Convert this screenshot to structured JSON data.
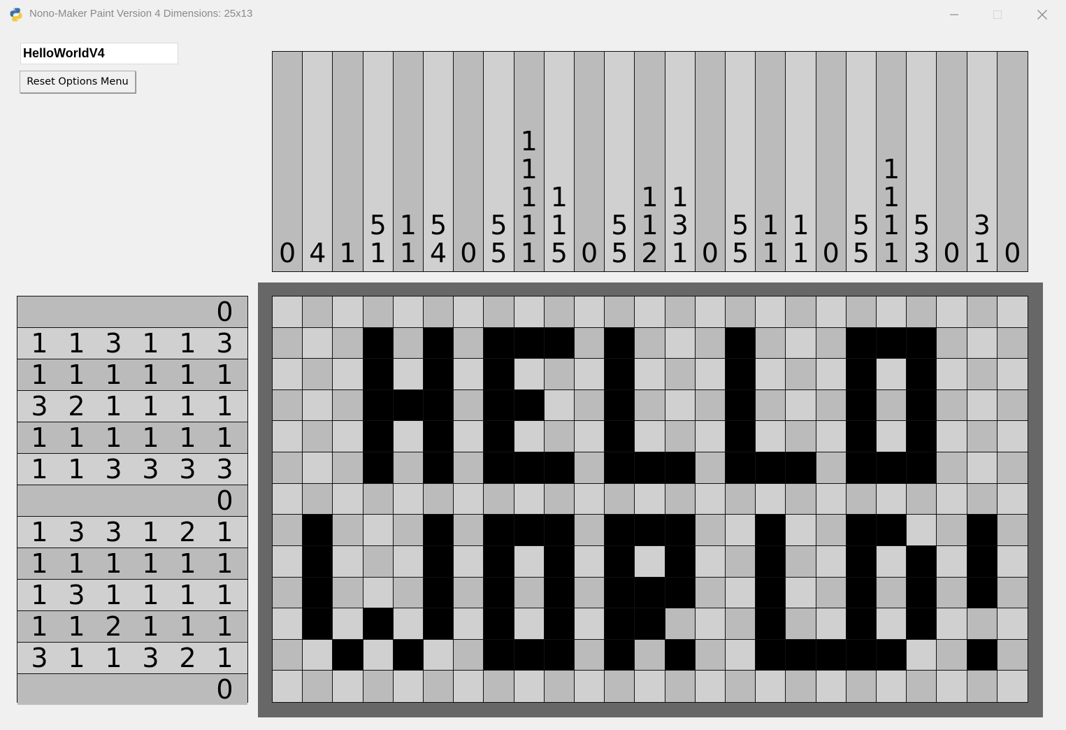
{
  "window": {
    "title": "Nono-Maker Paint Version 4 Dimensions: 25x13",
    "icon": "python-icon",
    "controls": [
      "minimize-icon",
      "maximize-icon",
      "close-icon"
    ]
  },
  "options": {
    "name_value": "HelloWorldV4",
    "reset_label": "Reset Options Menu"
  },
  "colors": {
    "filled": "#000000",
    "shade_dark": "#bbbbbb",
    "shade_light": "#d0d0d0",
    "frame": "#676767"
  },
  "puzzle": {
    "width": 25,
    "height": 13,
    "column_clues": [
      [
        "0"
      ],
      [
        "4"
      ],
      [
        "1"
      ],
      [
        "5",
        "1"
      ],
      [
        "1",
        "1"
      ],
      [
        "5",
        "4"
      ],
      [
        "0"
      ],
      [
        "5",
        "5"
      ],
      [
        "1",
        "1",
        "1",
        "1",
        "1"
      ],
      [
        "1",
        "1",
        "5"
      ],
      [
        "0"
      ],
      [
        "5",
        "5"
      ],
      [
        "1",
        "1",
        "2"
      ],
      [
        "1",
        "3",
        "1"
      ],
      [
        "0"
      ],
      [
        "5",
        "5"
      ],
      [
        "1",
        "1"
      ],
      [
        "1",
        "1"
      ],
      [
        "0"
      ],
      [
        "5",
        "5"
      ],
      [
        "1",
        "1",
        "1",
        "1"
      ],
      [
        "5",
        "3"
      ],
      [
        "0"
      ],
      [
        "3",
        "1"
      ],
      [
        "0"
      ]
    ],
    "row_clues": [
      [
        "0"
      ],
      [
        "1",
        "1",
        "3",
        "1",
        "1",
        "3"
      ],
      [
        "1",
        "1",
        "1",
        "1",
        "1",
        "1"
      ],
      [
        "3",
        "2",
        "1",
        "1",
        "1",
        "1"
      ],
      [
        "1",
        "1",
        "1",
        "1",
        "1",
        "1"
      ],
      [
        "1",
        "1",
        "3",
        "3",
        "3",
        "3"
      ],
      [
        "0"
      ],
      [
        "1",
        "3",
        "3",
        "1",
        "2",
        "1"
      ],
      [
        "1",
        "1",
        "1",
        "1",
        "1",
        "1"
      ],
      [
        "1",
        "3",
        "1",
        "1",
        "1",
        "1"
      ],
      [
        "1",
        "1",
        "2",
        "1",
        "1",
        "1"
      ],
      [
        "3",
        "1",
        "1",
        "3",
        "2",
        "1"
      ],
      [
        "0"
      ]
    ],
    "grid": [
      "0000000000000000000000000",
      "0001010111010001000111000",
      "0001010100010001000101000",
      "0001110110010001000101000",
      "0001010100010001000101000",
      "0001010111011101110111000",
      "0000000000000000000000000",
      "0100010111011100100110010",
      "0100010101010100100101010",
      "0100010101011100100101010",
      "0101010101011000100101000",
      "0010100111010100111110010",
      "0000000000000000000000000"
    ]
  }
}
